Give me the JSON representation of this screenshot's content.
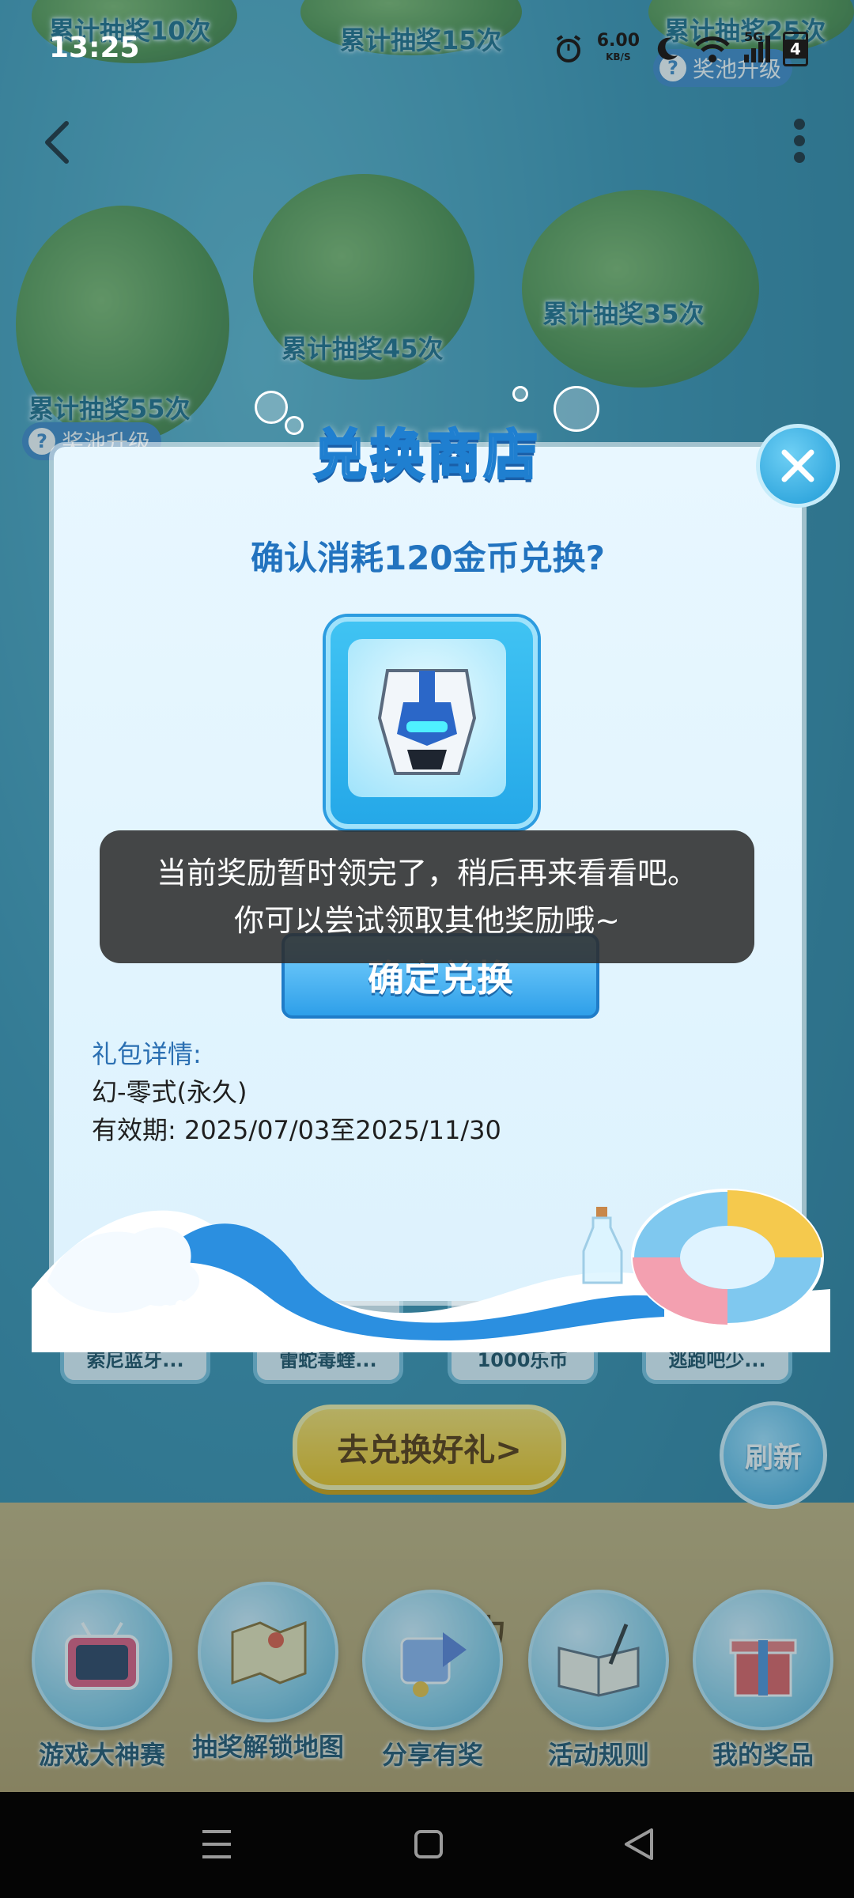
{
  "status_bar": {
    "time": "13:25",
    "net_speed": "6.00",
    "net_unit": "KB/S",
    "signal": "5G",
    "battery": "4"
  },
  "background": {
    "milestones": [
      "累计抽奖10次",
      "累计抽奖15次",
      "累计抽奖25次",
      "累计抽奖35次",
      "累计抽奖45次",
      "累计抽奖55次"
    ],
    "pool_upgrade_top": "奖池升级",
    "pool_upgrade_left": "奖池升级",
    "rewards": [
      "索尼蓝牙...",
      "雷蛇毒蝰...",
      "1000乐币",
      "逃跑吧少..."
    ],
    "go_redeem": "去兑换好礼>",
    "refresh": "刷新",
    "partial_text": "力",
    "bottom_menu": [
      "游戏大神赛",
      "抽奖解锁地图",
      "分享有奖",
      "活动规则",
      "我的奖品"
    ]
  },
  "modal": {
    "title": "兑换商店",
    "question": "确认消耗120金币兑换?",
    "confirm": "确定兑换",
    "detail_title": "礼包详情:",
    "detail_item": "幻-零式(永久)",
    "validity": "有效期: 2025/07/03至2025/11/30"
  },
  "toast": {
    "line1": "当前奖励暂时领完了，稍后再来看看吧。",
    "line2": "你可以尝试领取其他奖励哦~"
  },
  "colors": {
    "accent": "#2273bf",
    "toast_bg": "#2d2d2d",
    "button_yellow": "#f6c417"
  }
}
